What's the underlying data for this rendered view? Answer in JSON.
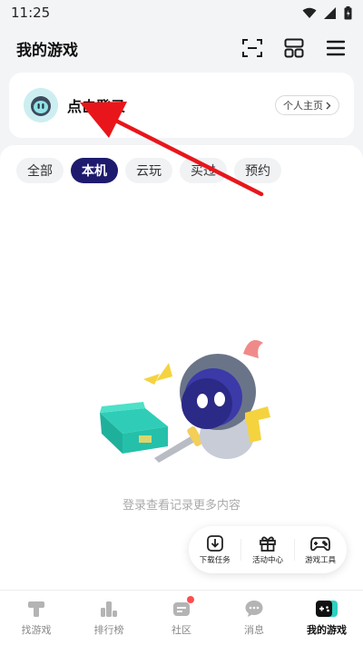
{
  "status_bar": {
    "time": "11:25"
  },
  "header": {
    "title": "我的游戏"
  },
  "login_card": {
    "label": "点击登录",
    "profile_button": "个人主页"
  },
  "tabs": [
    {
      "label": "全部"
    },
    {
      "label": "本机",
      "active": true
    },
    {
      "label": "云玩"
    },
    {
      "label": "买过"
    },
    {
      "label": "预约"
    }
  ],
  "empty_state": {
    "text": "登录查看记录更多内容"
  },
  "quick_tools": [
    {
      "label": "下载任务",
      "icon": "download-icon"
    },
    {
      "label": "活动中心",
      "icon": "gift-icon"
    },
    {
      "label": "游戏工具",
      "icon": "gamepad-icon"
    }
  ],
  "bottom_nav": [
    {
      "label": "找游戏",
      "icon": "hammer-icon"
    },
    {
      "label": "排行榜",
      "icon": "podium-icon"
    },
    {
      "label": "社区",
      "icon": "community-icon",
      "badge": true
    },
    {
      "label": "消息",
      "icon": "chat-icon"
    },
    {
      "label": "我的游戏",
      "icon": "my-games-icon",
      "active": true
    }
  ],
  "colors": {
    "accent": "#1e1b6e",
    "badge": "#ff4d4f",
    "annotation_arrow": "#e8161b"
  }
}
